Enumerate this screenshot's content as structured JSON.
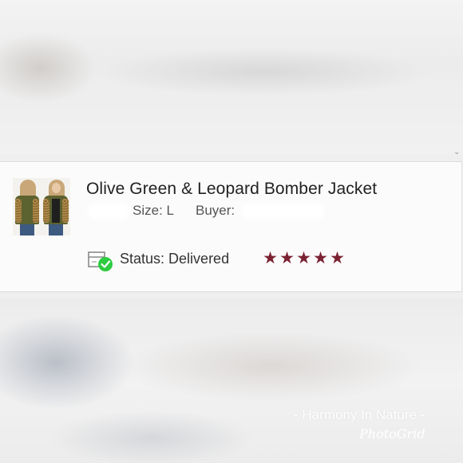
{
  "item": {
    "title": "Olive Green & Leopard Bomber Jacket",
    "size_label": "Size: L",
    "buyer_label": "Buyer:",
    "status_label": "Status:",
    "status_value": "Delivered"
  },
  "rating": {
    "stars": 5,
    "max": 5,
    "star_color": "#7b2232"
  },
  "icons": {
    "status": "package-delivered-icon",
    "star": "star-icon"
  },
  "colors": {
    "check_green": "#2ecc40",
    "star": "#7b2232"
  },
  "watermark": {
    "line1": "- Harmony In Nature -",
    "line2": "PhotoGrid"
  }
}
